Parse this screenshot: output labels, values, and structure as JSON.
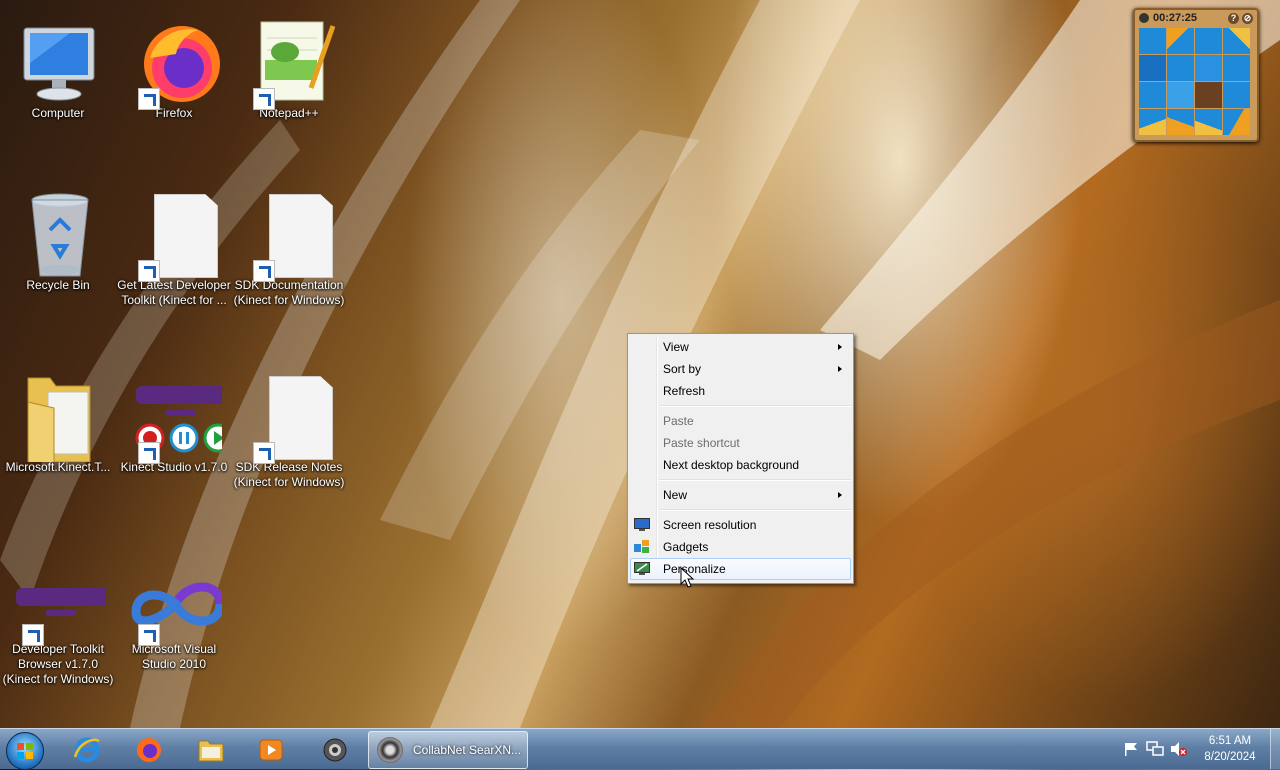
{
  "desktop": {
    "icons": [
      {
        "label": "Computer"
      },
      {
        "label": "Firefox"
      },
      {
        "label": "Notepad++"
      },
      {
        "label": "Recycle Bin"
      },
      {
        "label": "Get Latest Developer Toolkit (Kinect for ..."
      },
      {
        "label": "SDK Documentation (Kinect for Windows)"
      },
      {
        "label": "Microsoft.Kinect.T..."
      },
      {
        "label": "Kinect Studio v1.7.0"
      },
      {
        "label": "SDK Release Notes (Kinect for Windows)"
      },
      {
        "label": "Developer Toolkit Browser v1.7.0 (Kinect for Windows)"
      },
      {
        "label": "Microsoft Visual Studio 2010"
      }
    ]
  },
  "gadget": {
    "timer": "00:27:25",
    "help_glyph": "?",
    "close_glyph": "⊘"
  },
  "context_menu": {
    "items": [
      {
        "label": "View",
        "submenu": true,
        "enabled": true
      },
      {
        "label": "Sort by",
        "submenu": true,
        "enabled": true
      },
      {
        "label": "Refresh",
        "enabled": true
      },
      {
        "label": "Paste",
        "enabled": false
      },
      {
        "label": "Paste shortcut",
        "enabled": false
      },
      {
        "label": "Next desktop background",
        "enabled": true
      },
      {
        "label": "New",
        "submenu": true,
        "enabled": true
      },
      {
        "label": "Screen resolution",
        "icon": "monitor-icon",
        "enabled": true
      },
      {
        "label": "Gadgets",
        "icon": "gadgets-icon",
        "enabled": true
      },
      {
        "label": "Personalize",
        "icon": "personalize-icon",
        "enabled": true,
        "highlighted": true
      }
    ]
  },
  "taskbar": {
    "pinned": [
      "internet-explorer-icon",
      "firefox-icon",
      "file-explorer-icon",
      "media-player-icon",
      "kinect-app-icon"
    ],
    "active_window": {
      "label": "CollabNet SearXN...",
      "icon": "collabnet-icon"
    },
    "clock": {
      "time": "6:51 AM",
      "date": "8/20/2024"
    },
    "tray_icons": [
      "action-center-flag-icon",
      "network-icon",
      "volume-muted-icon"
    ]
  },
  "colors": {
    "taskbar": "#5f7fa5",
    "menu_bg": "#f0f0f0",
    "menu_highlight_border": "#aecff7",
    "gadget_frame": "#c99a5a"
  }
}
